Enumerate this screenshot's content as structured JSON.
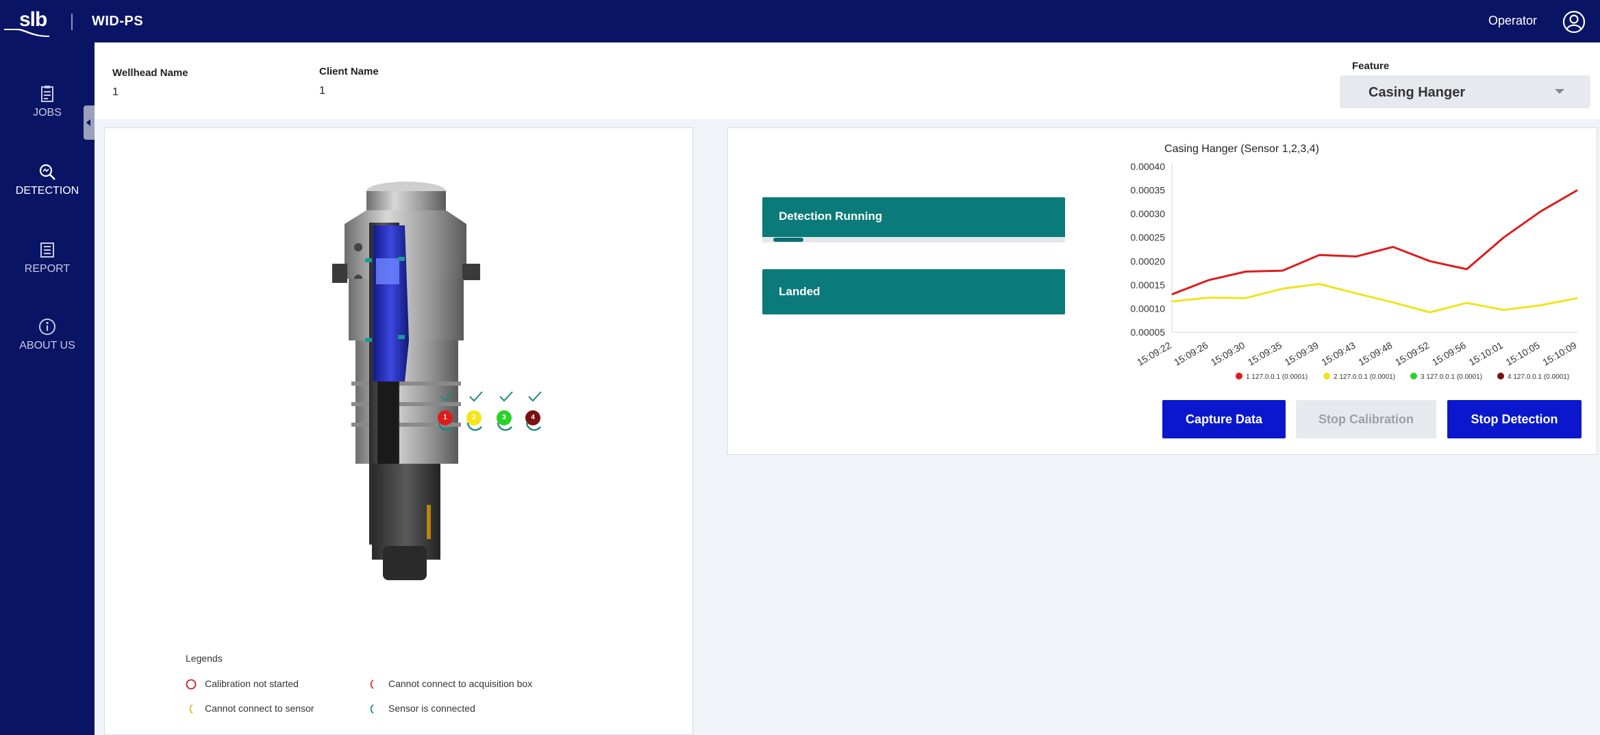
{
  "header": {
    "logo_text": "slb",
    "app_title": "WID-PS",
    "user_label": "Operator",
    "user_icon": "account-circle-icon"
  },
  "sidebar": {
    "items": [
      {
        "label": "JOBS",
        "icon": "clipboard-icon",
        "active": false
      },
      {
        "label": "DETECTION",
        "icon": "detection-icon",
        "active": true
      },
      {
        "label": "REPORT",
        "icon": "report-icon",
        "active": false
      },
      {
        "label": "ABOUT US",
        "icon": "info-icon",
        "active": false
      }
    ]
  },
  "info": {
    "wellhead_label": "Wellhead Name",
    "wellhead_value": "1",
    "client_label": "Client Name",
    "client_value": "1",
    "feature_label": "Feature",
    "feature_value": "Casing Hanger"
  },
  "sensors": [
    {
      "number": "1",
      "color": "#e01b1b"
    },
    {
      "number": "2",
      "color": "#f4e61a"
    },
    {
      "number": "3",
      "color": "#2bd12b"
    },
    {
      "number": "4",
      "color": "#7a1010"
    }
  ],
  "legends": {
    "title": "Legends",
    "items": [
      {
        "label": "Calibration not started",
        "symbol": "red-ring"
      },
      {
        "label": "Cannot connect to acquisition box",
        "symbol": "red-arc"
      },
      {
        "label": "Cannot connect to sensor",
        "symbol": "yellow-arc"
      },
      {
        "label": "Sensor is connected",
        "symbol": "teal-arc"
      }
    ]
  },
  "status": {
    "detection_label": "Detection Running",
    "detection_progress": 0.1,
    "landed_label": "Landed"
  },
  "chart_data": {
    "type": "line",
    "title": "Casing Hanger (Sensor 1,2,3,4)",
    "x": [
      "15:09:22",
      "15:09:26",
      "15:09:30",
      "15:09:35",
      "15:09:39",
      "15:09:43",
      "15:09:48",
      "15:09:52",
      "15:09:56",
      "15:10:01",
      "15:10:05",
      "15:10:09"
    ],
    "ylim": [
      5e-05,
      0.0004
    ],
    "yticks": [
      "0.00005",
      "0.00010",
      "0.00015",
      "0.00020",
      "0.00025",
      "0.00030",
      "0.00035",
      "0.00040"
    ],
    "grid": false,
    "legend_position": "bottom",
    "series": [
      {
        "name": "1 127.0.0.1 (0.0001)",
        "color": "#e01b1b",
        "values": [
          0.00013,
          0.00016,
          0.000178,
          0.00018,
          0.000213,
          0.00021,
          0.00023,
          0.0002,
          0.000183,
          0.00025,
          0.000305,
          0.00035
        ]
      },
      {
        "name": "2 127.0.0.1 (0.0001)",
        "color": "#f0e41c",
        "values": [
          0.000115,
          0.000123,
          0.000122,
          0.000142,
          0.000152,
          0.000132,
          0.000113,
          9.2e-05,
          0.000112,
          9.7e-05,
          0.000107,
          0.000122
        ]
      },
      {
        "name": "3 127.0.0.1 (0.0001)",
        "color": "#2bd12b",
        "values": []
      },
      {
        "name": "4 127.0.0.1 (0.0001)",
        "color": "#7a1010",
        "values": []
      }
    ]
  },
  "buttons": {
    "capture": "Capture Data",
    "stop_calibration": "Stop Calibration",
    "stop_detection": "Stop Detection"
  }
}
